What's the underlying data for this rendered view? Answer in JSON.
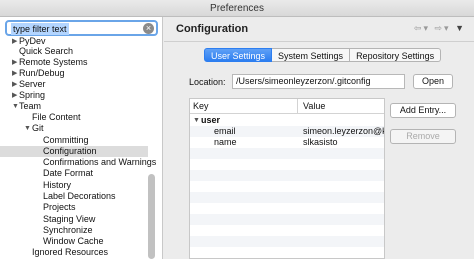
{
  "window": {
    "title": "Preferences"
  },
  "filter": {
    "value": "type filter text"
  },
  "tree": [
    {
      "label": "PyDev",
      "arrow": "▶"
    },
    {
      "label": "Quick Search",
      "arrow": ""
    },
    {
      "label": "Remote Systems",
      "arrow": "▶"
    },
    {
      "label": "Run/Debug",
      "arrow": "▶"
    },
    {
      "label": "Server",
      "arrow": "▶"
    },
    {
      "label": "Spring",
      "arrow": "▶"
    },
    {
      "label": "Team",
      "arrow": "▼"
    },
    {
      "label": "File Content",
      "arrow": ""
    },
    {
      "label": "Git",
      "arrow": "▼"
    },
    {
      "label": "Committing",
      "arrow": ""
    },
    {
      "label": "Configuration",
      "arrow": ""
    },
    {
      "label": "Confirmations and Warnings",
      "arrow": ""
    },
    {
      "label": "Date Format",
      "arrow": ""
    },
    {
      "label": "History",
      "arrow": ""
    },
    {
      "label": "Label Decorations",
      "arrow": ""
    },
    {
      "label": "Projects",
      "arrow": ""
    },
    {
      "label": "Staging View",
      "arrow": ""
    },
    {
      "label": "Synchronize",
      "arrow": ""
    },
    {
      "label": "Window Cache",
      "arrow": ""
    },
    {
      "label": "Ignored Resources",
      "arrow": ""
    }
  ],
  "page": {
    "title": "Configuration",
    "tabs": [
      "User Settings",
      "System Settings",
      "Repository Settings"
    ],
    "location_label": "Location:",
    "location_value": "/Users/simeonleyzerzon/.gitconfig",
    "open_label": "Open",
    "add_entry_label": "Add Entry...",
    "remove_label": "Remove",
    "nav_icons": [
      "back-icon",
      "forward-icon",
      "menu-icon"
    ]
  },
  "table": {
    "headers": [
      "Key",
      "Value"
    ],
    "rows": [
      {
        "key": "user",
        "value": "",
        "arrow": "▼"
      },
      {
        "key": "email",
        "value": "simeon.leyzerzon@k",
        "arrow": ""
      },
      {
        "key": "name",
        "value": "slkasisto",
        "arrow": ""
      }
    ]
  }
}
